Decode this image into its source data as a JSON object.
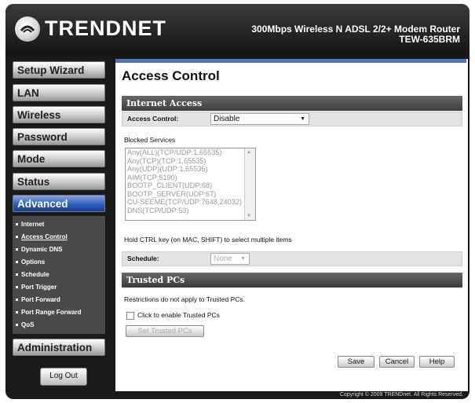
{
  "header": {
    "brand": "TRENDNET",
    "model_line1": "300Mbps Wireless N ADSL 2/2+ Modem Router",
    "model_line2": "TEW-635BRM"
  },
  "sidebar": {
    "items": [
      {
        "label": "Setup Wizard"
      },
      {
        "label": "LAN"
      },
      {
        "label": "Wireless"
      },
      {
        "label": "Password"
      },
      {
        "label": "Mode"
      },
      {
        "label": "Status"
      },
      {
        "label": "Advanced"
      },
      {
        "label": "Administration"
      }
    ],
    "advanced_subitems": [
      {
        "label": "Internet"
      },
      {
        "label": "Access Control"
      },
      {
        "label": "Dynamic DNS"
      },
      {
        "label": "Options"
      },
      {
        "label": "Schedule"
      },
      {
        "label": "Port Trigger"
      },
      {
        "label": "Port Forward"
      },
      {
        "label": "Port Range Forward"
      },
      {
        "label": "QoS"
      }
    ],
    "logout": "Log Out"
  },
  "main": {
    "title": "Access Control",
    "internet_access": {
      "heading": "Internet Access",
      "access_control_label": "Access Control:",
      "access_control_value": "Disable",
      "blocked_services_label": "Blocked Services",
      "blocked_services": [
        "Any(ALL)(TCP/UDP:1,65535)",
        "Any(TCP)(TCP:1,65535)",
        "Any(UDP)(UDP:1,65535)",
        "AIM(TCP:5190)",
        "BOOTP_CLIENT(UDP:68)",
        "BOOTP_SERVER(UDP:67)",
        "CU-SEEME(TCP/UDP:7648,24032)",
        "DNS(TCP/UDP:53)"
      ],
      "hint": "Hold CTRL key (on MAC, SHIFT) to select multiple items",
      "schedule_label": "Schedule:",
      "schedule_value": "None"
    },
    "trusted_pcs": {
      "heading": "Trusted PCs",
      "note": "Restrictions do not apply to Trusted PCs.",
      "checkbox_label": "Click to enable Trusted PCs",
      "set_button": "Set Trusted PCs"
    },
    "buttons": {
      "save": "Save",
      "cancel": "Cancel",
      "help": "Help"
    }
  },
  "footer": {
    "copyright": "Copyright © 2009 TRENDnet. All Rights Reserved."
  }
}
